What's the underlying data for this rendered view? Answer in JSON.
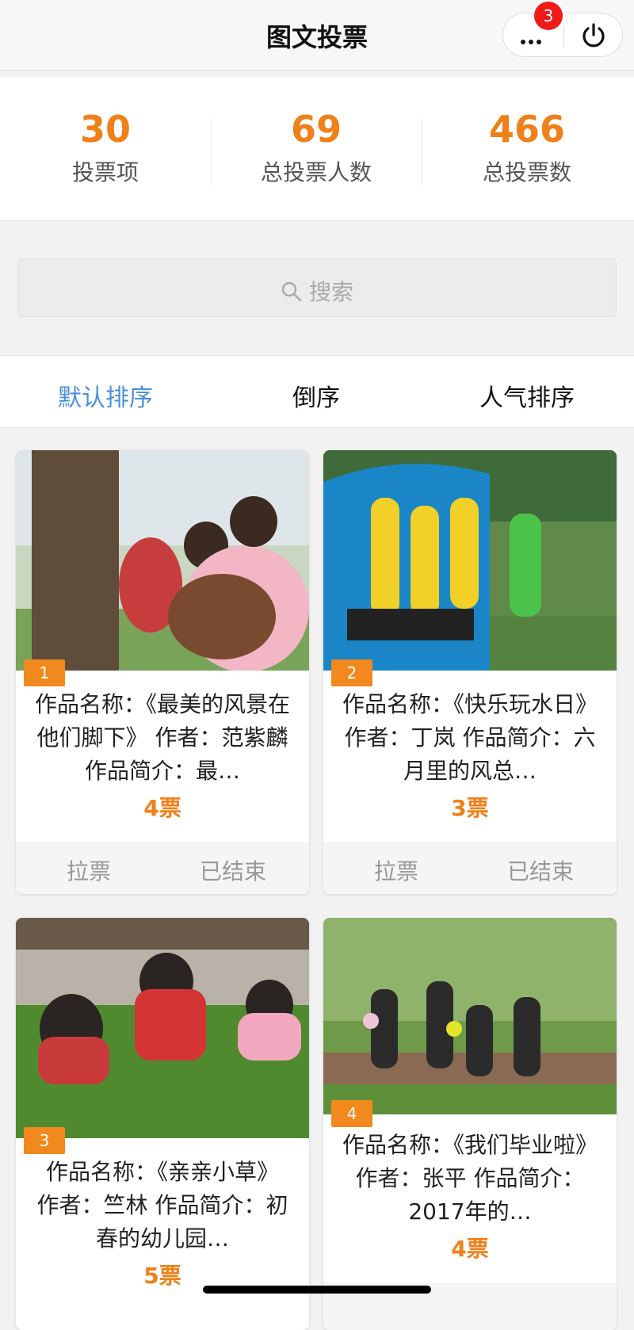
{
  "topbar": {
    "title": "图文投票",
    "badge_count": "3"
  },
  "stats": [
    {
      "value": "30",
      "label": "投票项"
    },
    {
      "value": "69",
      "label": "总投票人数"
    },
    {
      "value": "466",
      "label": "总投票数"
    }
  ],
  "search": {
    "placeholder": "搜索"
  },
  "tabs": [
    {
      "label": "默认排序",
      "active": true
    },
    {
      "label": "倒序",
      "active": false
    },
    {
      "label": "人气排序",
      "active": false
    }
  ],
  "colors": {
    "accent": "#f08019",
    "active_tab": "#4a90d9",
    "badge": "#ee1b1b",
    "rank_tag": "#f2891e"
  },
  "items": [
    {
      "rank": "1",
      "description": "作品名称：《最美的风景在他们脚下》 作者：范紫麟 作品简介：最…",
      "votes": "4票",
      "action_left": "拉票",
      "action_right": "已结束"
    },
    {
      "rank": "2",
      "description": "作品名称：《快乐玩水日》 作者：丁岚 作品简介：六月里的风总…",
      "votes": "3票",
      "action_left": "拉票",
      "action_right": "已结束"
    },
    {
      "rank": "3",
      "description": "作品名称：《亲亲小草》 作者：竺林 作品简介：初春的幼儿园…",
      "votes": "5票"
    },
    {
      "rank": "4",
      "description": "作品名称：《我们毕业啦》 作者：张平 作品简介：2017年的…",
      "votes": "4票"
    }
  ]
}
